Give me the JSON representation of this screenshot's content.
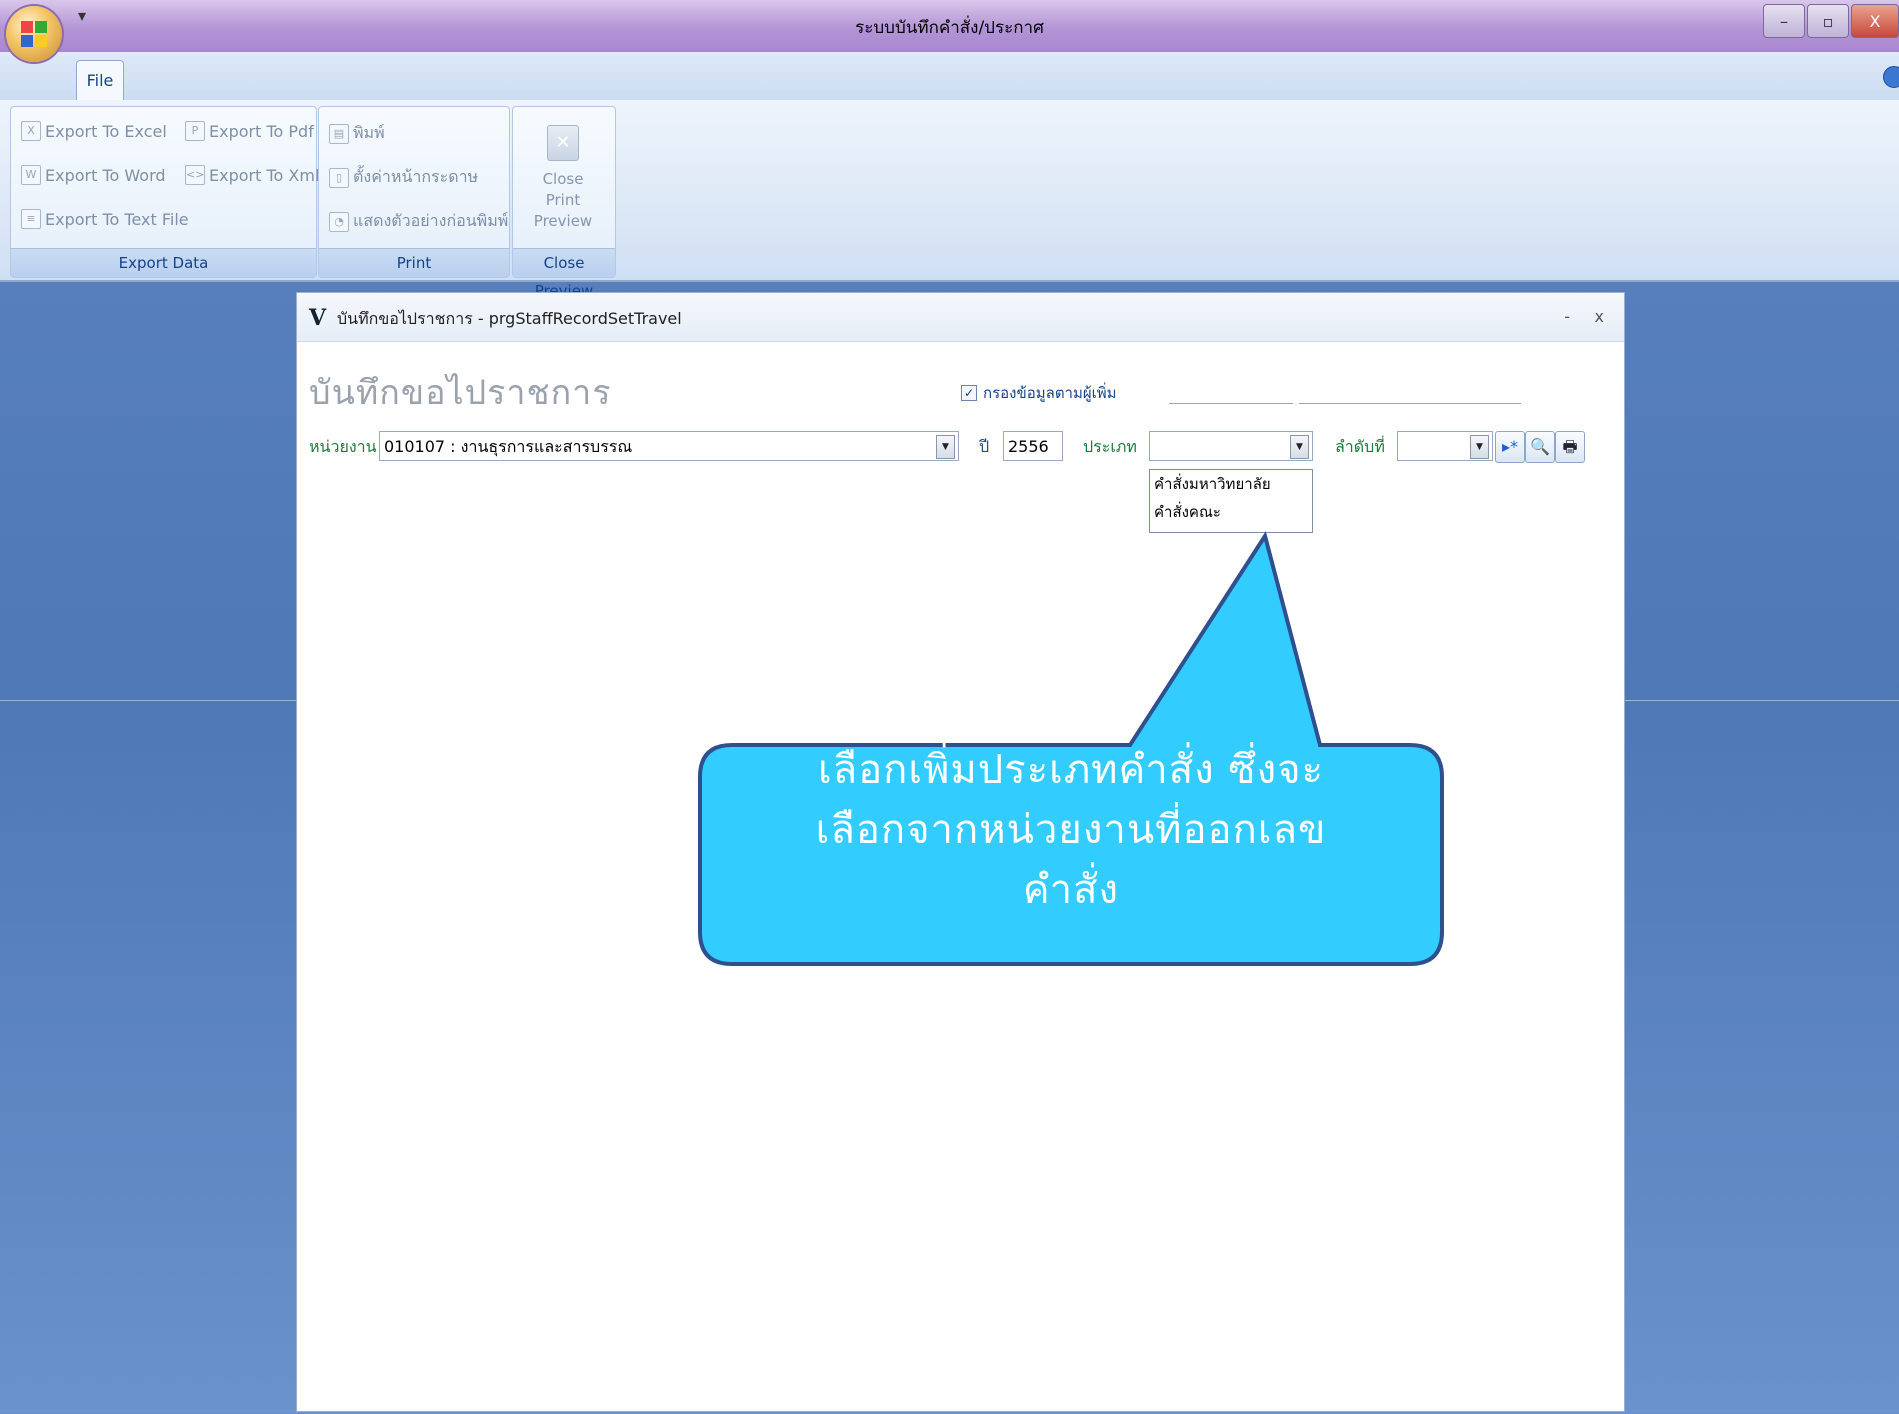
{
  "app": {
    "title": "ระบบบันทึกคำสั่ง/ประกาศ",
    "qat_glyph": "▾",
    "window_buttons": {
      "minimize": "–",
      "maximize": "▫",
      "close": "X"
    },
    "tab_file": "File"
  },
  "ribbon": {
    "groups": {
      "export": {
        "label": "Export Data",
        "buttons": [
          "Export To Excel",
          "Export To Pdf",
          "Export To Word",
          "Export To Xml",
          "Export To Text File"
        ]
      },
      "print": {
        "label": "Print",
        "buttons": [
          "พิมพ์",
          "ตั้งค่าหน้ากระดาษ",
          "แสดงตัวอย่างก่อนพิมพ์"
        ]
      },
      "close": {
        "label": "Close Preview",
        "button": [
          "Close Print",
          "Preview"
        ]
      }
    }
  },
  "child_window": {
    "title": "บันทึกขอไปราชการ - prgStaffRecordSetTravel",
    "logo": "V",
    "minimize": "-",
    "close": "x",
    "heading": "บันทึกขอไปราชการ",
    "filter_checkbox": {
      "label": "กรองข้อมูลตามผู้เพิ่ม",
      "checked": true,
      "mark": "✓"
    },
    "unit": {
      "label": "หน่วยงาน",
      "value": "010107 : งานธุรการและสารบรรณ"
    },
    "year": {
      "label": "ปี",
      "value": "2556"
    },
    "type": {
      "label": "ประเภท",
      "value": "",
      "options": [
        "คำสั่งมหาวิทยาลัย",
        "คำสั่งคณะ"
      ]
    },
    "seq": {
      "label": "ลำดับที่",
      "value": ""
    },
    "buttons": {
      "new": "▸*",
      "find": "🔍",
      "print": "🖶"
    }
  },
  "callout": {
    "lines": [
      "เลือกเพิ่มประเภทคำสั่ง ซึ่งจะ",
      "เลือกจากหน่วยงานที่ออกเลข",
      "คำสั่ง"
    ],
    "color": "#33ccff"
  }
}
